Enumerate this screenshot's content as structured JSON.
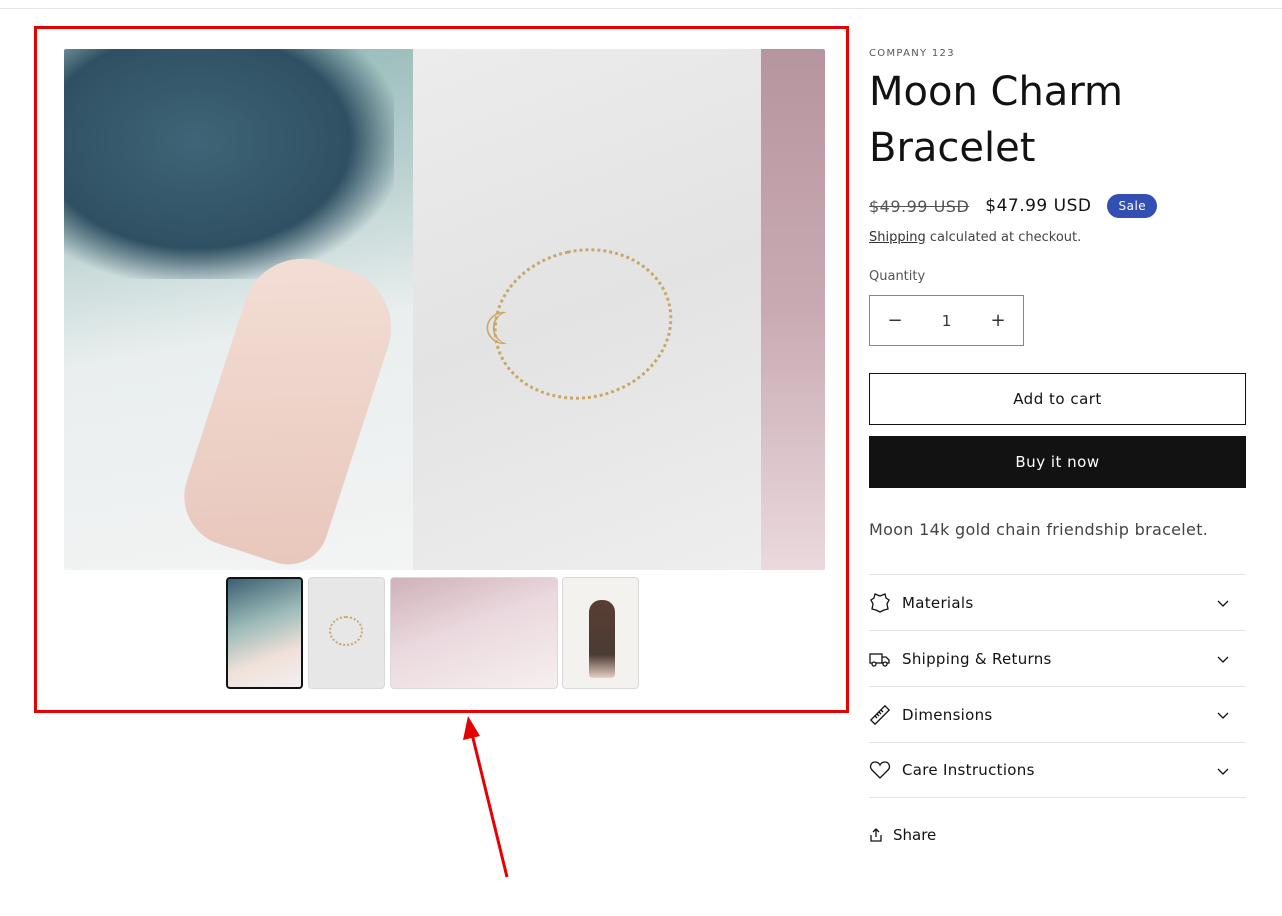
{
  "gallery": {
    "main_alt": "Moon Charm Bracelet product image",
    "thumbnails": [
      {
        "label": "thumbnail-1",
        "active": true
      },
      {
        "label": "thumbnail-2",
        "active": false
      },
      {
        "label": "thumbnail-3",
        "active": false
      },
      {
        "label": "thumbnail-4",
        "active": false
      }
    ]
  },
  "annotation": {
    "color": "#e60000"
  },
  "product": {
    "vendor": "COMPANY 123",
    "title_line1": "Moon Charm",
    "title_line2": "Bracelet",
    "price_regular": "$49.99 USD",
    "price_sale": "$47.99 USD",
    "sale_badge": "Sale",
    "shipping_link": "Shipping",
    "shipping_text": " calculated at checkout.",
    "quantity_label": "Quantity",
    "quantity_value": "1",
    "quantity_minus": "−",
    "quantity_plus": "+",
    "add_to_cart": "Add to cart",
    "buy_now": "Buy it now",
    "description": "Moon 14k gold chain friendship bracelet."
  },
  "accordion": [
    {
      "label": "Materials",
      "icon": "leather-icon"
    },
    {
      "label": "Shipping & Returns",
      "icon": "truck-icon"
    },
    {
      "label": "Dimensions",
      "icon": "ruler-icon"
    },
    {
      "label": "Care Instructions",
      "icon": "heart-icon"
    }
  ],
  "share": {
    "label": "Share",
    "icon": "share-icon"
  },
  "colors": {
    "sale_badge": "#334fb4",
    "buy_button": "#121212",
    "text": "#121212"
  }
}
